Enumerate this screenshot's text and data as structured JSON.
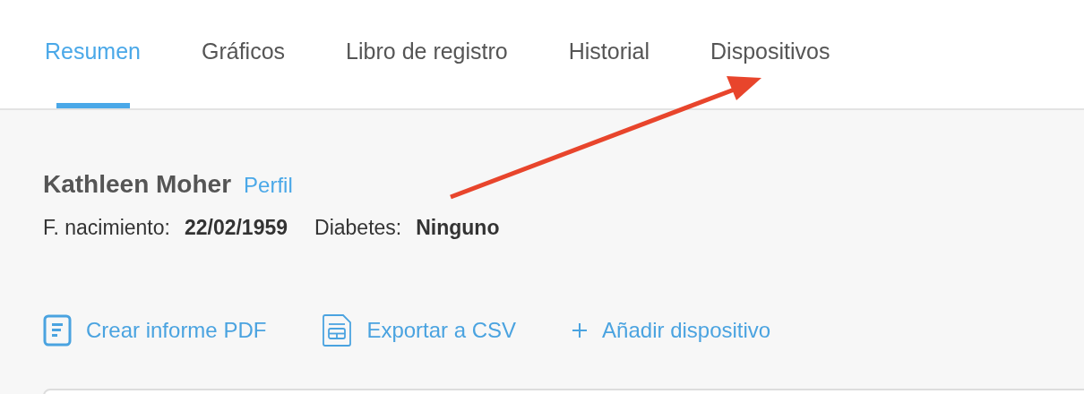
{
  "tabs": [
    {
      "label": "Resumen",
      "selected": true
    },
    {
      "label": "Gráficos",
      "selected": false
    },
    {
      "label": "Libro de registro",
      "selected": false
    },
    {
      "label": "Historial",
      "selected": false
    },
    {
      "label": "Dispositivos",
      "selected": false
    }
  ],
  "patient": {
    "name": "Kathleen Moher",
    "profile_link": "Perfil",
    "birth_label": "F. nacimiento:",
    "birth_date": "22/02/1959",
    "diabetes_label": "Diabetes:",
    "diabetes_value": "Ninguno"
  },
  "actions": [
    {
      "kind": "pdf",
      "label": "Crear informe PDF"
    },
    {
      "kind": "csv",
      "label": "Exportar a CSV"
    },
    {
      "kind": "add",
      "label": "Añadir dispositivo"
    }
  ]
}
